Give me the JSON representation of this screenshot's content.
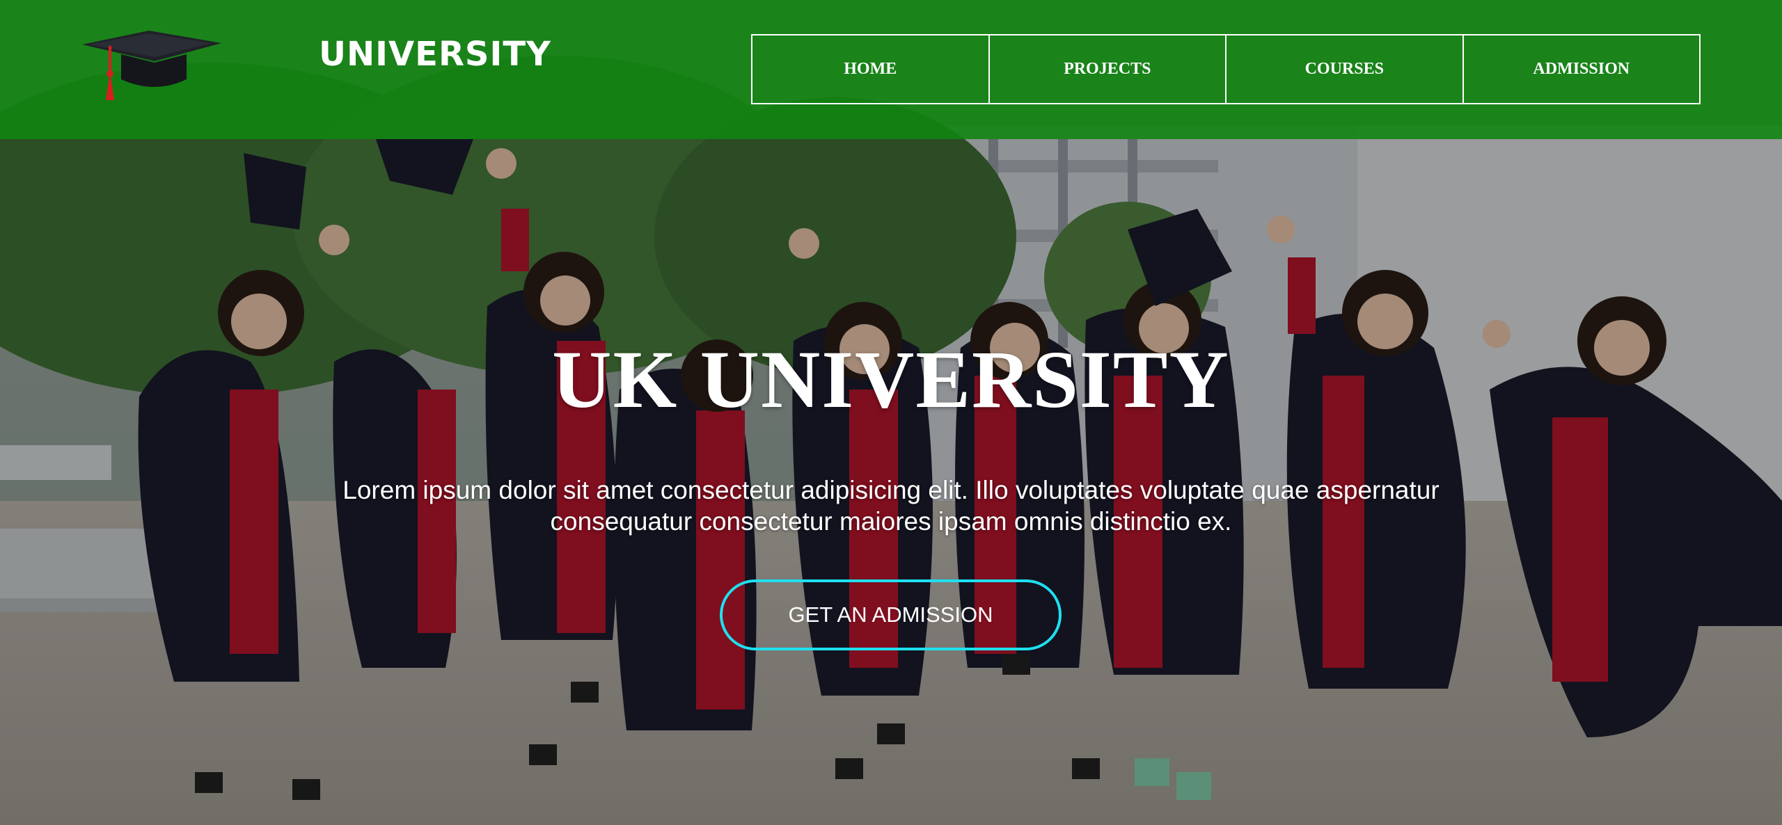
{
  "header": {
    "logo_text": "UNIVERSITY",
    "logo_icon": "graduation-cap-icon",
    "background_color": "#108010"
  },
  "nav": {
    "items": [
      {
        "label": "HOME"
      },
      {
        "label": "PROJECTS"
      },
      {
        "label": "COURSES"
      },
      {
        "label": "ADMISSION"
      }
    ]
  },
  "hero": {
    "title": "UK UNIVERSITY",
    "description": "Lorem ipsum dolor sit amet consectetur adipisicing elit. Illo voluptates voluptate quae aspernatur consequatur consectetur maiores ipsam omnis distinctio ex.",
    "cta_label": "GET AN ADMISSION",
    "cta_border_color": "#1ee0f0",
    "background_image": "graduates-jumping-photo"
  }
}
